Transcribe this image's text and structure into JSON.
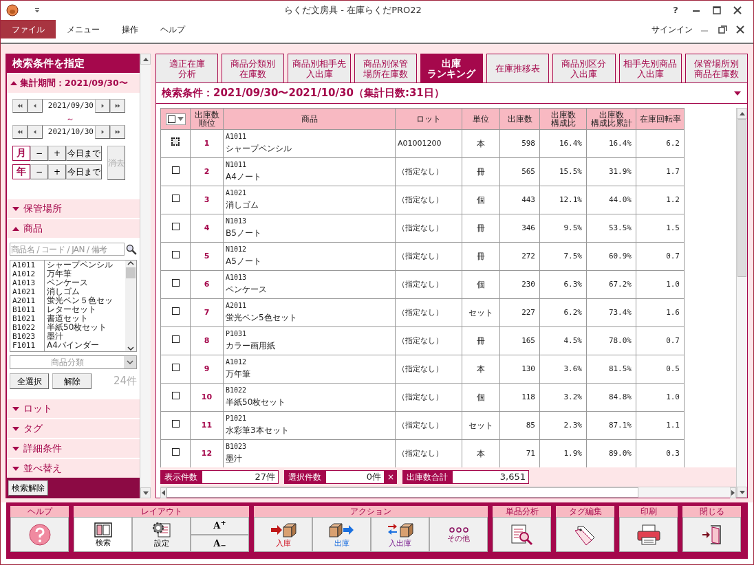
{
  "window": {
    "title": "らくだ文房具 - 在庫らくだPRO22",
    "help": "?",
    "signin": "サインイン"
  },
  "menu": [
    {
      "label": "ファイル",
      "selected": true
    },
    {
      "label": "メニュー",
      "selected": false
    },
    {
      "label": "操作",
      "selected": false
    },
    {
      "label": "ヘルプ",
      "selected": false
    }
  ],
  "sidebar": {
    "title": "検索条件を指定",
    "sections": [
      {
        "kind": "period",
        "label": "集計期間：2021/09/30〜",
        "expanded": true
      },
      {
        "kind": "plain",
        "label": "保管場所",
        "expanded": false
      },
      {
        "kind": "products",
        "label": "商品",
        "expanded": true
      },
      {
        "kind": "plain",
        "label": "ロット",
        "expanded": false
      },
      {
        "kind": "plain",
        "label": "タグ",
        "expanded": false
      },
      {
        "kind": "plain",
        "label": "詳細条件",
        "expanded": false
      },
      {
        "kind": "plain",
        "label": "並べ替え",
        "expanded": false
      }
    ],
    "period": {
      "from": "2021/09/30",
      "separator": "～",
      "to": "2021/10/30",
      "steps": [
        {
          "unit": "月",
          "minus": "−",
          "plus": "+",
          "today": "今日まで"
        },
        {
          "unit": "年",
          "minus": "−",
          "plus": "+",
          "today": "今日まで"
        }
      ],
      "clear": {
        "label": "消去",
        "disabled": true
      }
    },
    "products": {
      "placeholder": "商品名 / コード / JAN / 備考",
      "items": [
        {
          "code": "A1011",
          "name": "シャープペンシル"
        },
        {
          "code": "A1012",
          "name": "万年筆"
        },
        {
          "code": "A1013",
          "name": "ペンケース"
        },
        {
          "code": "A1021",
          "name": "消しゴム"
        },
        {
          "code": "A2011",
          "name": "蛍光ペン５色セッ"
        },
        {
          "code": "B1011",
          "name": "レターセット"
        },
        {
          "code": "B1021",
          "name": "書道セット"
        },
        {
          "code": "B1022",
          "name": "半紙50枚セット"
        },
        {
          "code": "B1023",
          "name": "墨汁"
        },
        {
          "code": "F1011",
          "name": "A4バインダー"
        }
      ],
      "category_placeholder": "商品分類",
      "select_all": "全選択",
      "deselect": "解除",
      "count": "24件"
    },
    "reset": "検索解除"
  },
  "tabs": [
    {
      "lines": [
        "適正在庫",
        "分析"
      ],
      "selected": false
    },
    {
      "lines": [
        "商品分類別",
        "在庫数"
      ],
      "selected": false
    },
    {
      "lines": [
        "商品別相手先",
        "入出庫"
      ],
      "selected": false
    },
    {
      "lines": [
        "商品別保管",
        "場所在庫数"
      ],
      "selected": false
    },
    {
      "lines": [
        "出庫",
        "ランキング"
      ],
      "selected": true
    },
    {
      "lines": [
        "在庫推移表"
      ],
      "selected": false
    },
    {
      "lines": [
        "商品別区分",
        "入出庫"
      ],
      "selected": false
    },
    {
      "lines": [
        "相手先別商品",
        "入出庫"
      ],
      "selected": false
    },
    {
      "lines": [
        "保管場所別",
        "商品在庫数"
      ],
      "selected": false
    }
  ],
  "condition": "検索条件：2021/09/30〜2021/10/30（集計日数:31日）",
  "table": {
    "header_checkbox": {
      "checked": false
    },
    "columns": [
      {
        "lines": [
          "出庫数",
          "順位"
        ]
      },
      {
        "lines": [
          "商品"
        ]
      },
      {
        "lines": [
          "ロット"
        ]
      },
      {
        "lines": [
          "単位"
        ]
      },
      {
        "lines": [
          "出庫数"
        ]
      },
      {
        "lines": [
          "出庫数",
          "構成比"
        ]
      },
      {
        "lines": [
          "出庫数",
          "構成比累計"
        ]
      },
      {
        "lines": [
          "在庫回転率"
        ]
      }
    ],
    "rows": [
      {
        "checked": false,
        "focused": true,
        "rank": "1",
        "code": "A1011",
        "name": "シャープペンシル",
        "lot": "A01001200",
        "unit": "本",
        "qty": "598",
        "ratio": "16.4%",
        "cumulative": "16.4%",
        "turnover": "6.2"
      },
      {
        "checked": false,
        "focused": false,
        "rank": "2",
        "code": "N1011",
        "name": "A4ノート",
        "lot": "（指定なし）",
        "unit": "冊",
        "qty": "565",
        "ratio": "15.5%",
        "cumulative": "31.9%",
        "turnover": "1.7"
      },
      {
        "checked": false,
        "focused": false,
        "rank": "3",
        "code": "A1021",
        "name": "消しゴム",
        "lot": "（指定なし）",
        "unit": "個",
        "qty": "443",
        "ratio": "12.1%",
        "cumulative": "44.0%",
        "turnover": "1.2"
      },
      {
        "checked": false,
        "focused": false,
        "rank": "4",
        "code": "N1013",
        "name": "B5ノート",
        "lot": "（指定なし）",
        "unit": "冊",
        "qty": "346",
        "ratio": "9.5%",
        "cumulative": "53.5%",
        "turnover": "1.5"
      },
      {
        "checked": false,
        "focused": false,
        "rank": "5",
        "code": "N1012",
        "name": "A5ノート",
        "lot": "（指定なし）",
        "unit": "冊",
        "qty": "272",
        "ratio": "7.5%",
        "cumulative": "60.9%",
        "turnover": "0.7"
      },
      {
        "checked": false,
        "focused": false,
        "rank": "6",
        "code": "A1013",
        "name": "ペンケース",
        "lot": "（指定なし）",
        "unit": "個",
        "qty": "230",
        "ratio": "6.3%",
        "cumulative": "67.2%",
        "turnover": "1.0"
      },
      {
        "checked": false,
        "focused": false,
        "rank": "7",
        "code": "A2011",
        "name": "蛍光ペン5色セット",
        "lot": "（指定なし）",
        "unit": "セット",
        "qty": "227",
        "ratio": "6.2%",
        "cumulative": "73.4%",
        "turnover": "1.6"
      },
      {
        "checked": false,
        "focused": false,
        "rank": "8",
        "code": "P1031",
        "name": "カラー画用紙",
        "lot": "（指定なし）",
        "unit": "冊",
        "qty": "165",
        "ratio": "4.5%",
        "cumulative": "78.0%",
        "turnover": "0.7"
      },
      {
        "checked": false,
        "focused": false,
        "rank": "9",
        "code": "A1012",
        "name": "万年筆",
        "lot": "（指定なし）",
        "unit": "本",
        "qty": "130",
        "ratio": "3.6%",
        "cumulative": "81.5%",
        "turnover": "0.5"
      },
      {
        "checked": false,
        "focused": false,
        "rank": "10",
        "code": "B1022",
        "name": "半紙50枚セット",
        "lot": "（指定なし）",
        "unit": "個",
        "qty": "118",
        "ratio": "3.2%",
        "cumulative": "84.8%",
        "turnover": "1.0"
      },
      {
        "checked": false,
        "focused": false,
        "rank": "11",
        "code": "P1021",
        "name": "水彩筆3本セット",
        "lot": "（指定なし）",
        "unit": "セット",
        "qty": "85",
        "ratio": "2.3%",
        "cumulative": "87.1%",
        "turnover": "1.1"
      },
      {
        "checked": false,
        "focused": false,
        "rank": "12",
        "code": "B1023",
        "name": "墨汁",
        "lot": "（指定なし）",
        "unit": "本",
        "qty": "71",
        "ratio": "1.9%",
        "cumulative": "89.0%",
        "turnover": "0.3"
      }
    ]
  },
  "summary": [
    {
      "label": "表示件数",
      "value": "27件"
    },
    {
      "label": "選択件数",
      "value": "0件",
      "clear": "×"
    },
    {
      "label": "出庫数合計",
      "value": "3,651"
    }
  ],
  "toolbar": [
    {
      "label": "ヘルプ",
      "buttons": [
        {
          "kind": "help"
        }
      ]
    },
    {
      "label": "レイアウト",
      "buttons": [
        {
          "kind": "layout",
          "label": "検索",
          "selected": true
        },
        {
          "kind": "settings",
          "label": "設定",
          "selected": false
        },
        {
          "kind": "font",
          "items": [
            "A$^{+}$",
            "A$_{−}$"
          ]
        }
      ]
    },
    {
      "label": "アクション",
      "buttons": [
        {
          "kind": "in",
          "label": "入庫"
        },
        {
          "kind": "out",
          "label": "出庫"
        },
        {
          "kind": "inout",
          "label": "入出庫"
        },
        {
          "kind": "other",
          "label": "その他"
        }
      ]
    },
    {
      "label": "単品分析",
      "buttons": [
        {
          "kind": "analysis"
        }
      ]
    },
    {
      "label": "タグ編集",
      "buttons": [
        {
          "kind": "tag"
        }
      ]
    },
    {
      "label": "印刷",
      "buttons": [
        {
          "kind": "print"
        }
      ]
    },
    {
      "label": "閉じる",
      "buttons": [
        {
          "kind": "close"
        }
      ]
    }
  ]
}
